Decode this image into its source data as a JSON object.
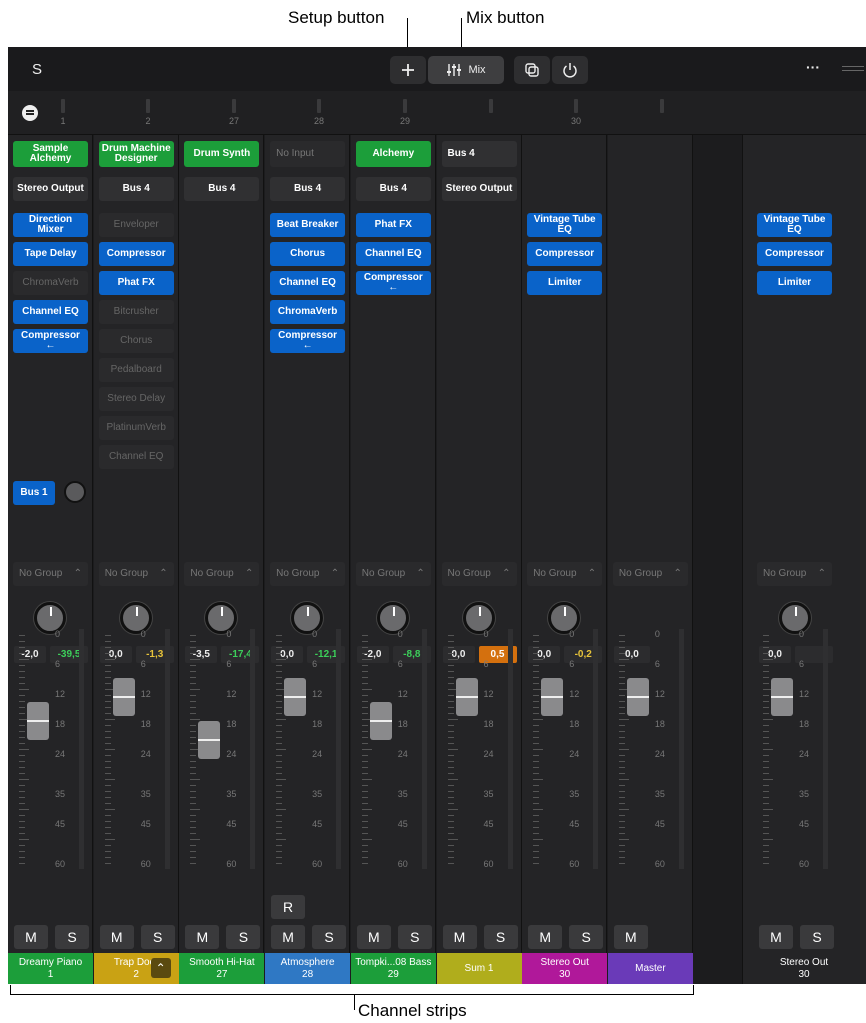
{
  "callouts": {
    "setup": "Setup button",
    "mix": "Mix button",
    "strips": "Channel strips"
  },
  "toolbar": {
    "left_label": "S",
    "add_icon": "plus-icon",
    "mix_icon": "mixer-sliders-icon",
    "mix_label": "Mix",
    "more": "···"
  },
  "ruler": [
    "1",
    "2",
    "27",
    "28",
    "29",
    "",
    "30"
  ],
  "strips": [
    {
      "input": "Sample Alchemy",
      "input_style": "green",
      "output": "Stereo Output",
      "plugins": [
        {
          "n": "Direction Mixer",
          "on": true
        },
        {
          "n": "Tape Delay",
          "on": true
        },
        {
          "n": "ChromaVerb",
          "on": false
        },
        {
          "n": "Channel EQ",
          "on": true
        },
        {
          "n": "Compressor ←",
          "on": true
        }
      ],
      "send": "Bus 1",
      "group": "No Group",
      "vol": "-2,0",
      "peak": "-39,5",
      "peak_color": "#3ccf5a",
      "peak_bg": "#2c2c2e",
      "fader_level": 0.32,
      "name": "Dreamy Piano",
      "num": "1",
      "color": "#1c9e3a",
      "rec": false,
      "ms": [
        "M",
        "S"
      ]
    },
    {
      "input": "Drum Machine Designer",
      "input_style": "green",
      "output": "Bus 4",
      "plugins": [
        {
          "n": "Enveloper",
          "on": false
        },
        {
          "n": "Compressor",
          "on": true
        },
        {
          "n": "Phat FX",
          "on": true
        },
        {
          "n": "Bitcrusher",
          "on": false
        },
        {
          "n": "Chorus",
          "on": false
        },
        {
          "n": "Pedalboard",
          "on": false
        },
        {
          "n": "Stereo Delay",
          "on": false
        },
        {
          "n": "PlatinumVerb",
          "on": false
        },
        {
          "n": "Channel EQ",
          "on": false
        }
      ],
      "send": "",
      "group": "No Group",
      "vol": "0,0",
      "peak": "-1,3",
      "peak_color": "#e8c43a",
      "peak_bg": "#2c2c2e",
      "fader_level": 0.22,
      "name": "Trap Door",
      "num": "2",
      "color": "#c9a214",
      "rec": false,
      "ms": [
        "M",
        "S"
      ]
    },
    {
      "input": "Drum Synth",
      "input_style": "green",
      "output": "Bus 4",
      "plugins": [],
      "send": "",
      "group": "No Group",
      "vol": "-3,5",
      "peak": "-17,4",
      "peak_color": "#3ccf5a",
      "peak_bg": "#2c2c2e",
      "fader_level": 0.4,
      "name": "Smooth Hi-Hat",
      "num": "27",
      "color": "#1c9e3a",
      "rec": false,
      "ms": [
        "M",
        "S"
      ]
    },
    {
      "input": "No Input",
      "input_style": "dark",
      "output": "Bus 4",
      "plugins": [
        {
          "n": "Beat Breaker",
          "on": true
        },
        {
          "n": "Chorus",
          "on": true
        },
        {
          "n": "Channel EQ",
          "on": true
        },
        {
          "n": "ChromaVerb",
          "on": true
        },
        {
          "n": "Compressor ←",
          "on": true
        }
      ],
      "send": "",
      "group": "No Group",
      "vol": "0,0",
      "peak": "-12,1",
      "peak_color": "#3ccf5a",
      "peak_bg": "#2c2c2e",
      "fader_level": 0.22,
      "name": "Atmosphere",
      "num": "28",
      "color": "#2f78c4",
      "rec": true,
      "rec_label": "R",
      "ms": [
        "M",
        "S"
      ]
    },
    {
      "input": "Alchemy",
      "input_style": "green",
      "output": "Bus 4",
      "plugins": [
        {
          "n": "Phat FX",
          "on": true
        },
        {
          "n": "Channel EQ",
          "on": true
        },
        {
          "n": "Compressor ←",
          "on": true
        }
      ],
      "send": "",
      "group": "No Group",
      "vol": "-2,0",
      "peak": "-8,8",
      "peak_color": "#3ccf5a",
      "peak_bg": "#2c2c2e",
      "fader_level": 0.32,
      "name": "Tompki...08 Bass",
      "num": "29",
      "color": "#1c9e3a",
      "rec": false,
      "ms": [
        "M",
        "S"
      ]
    },
    {
      "input": "Bus 4",
      "input_style": "gray",
      "output": "Stereo Output",
      "plugins": [],
      "send": "",
      "group": "No Group",
      "vol": "0,0",
      "peak": "0,5",
      "peak_color": "#ffffff",
      "peak_bg": "#d4700e",
      "fader_level": 0.22,
      "name": "Sum 1",
      "num": "",
      "color": "#b0ad1c",
      "rec": false,
      "ms": [
        "M",
        "S"
      ]
    },
    {
      "input": "",
      "input_style": "none",
      "output": "",
      "plugins": [
        {
          "n": "Vintage Tube EQ",
          "on": true
        },
        {
          "n": "Compressor",
          "on": true
        },
        {
          "n": "Limiter",
          "on": true
        }
      ],
      "send": "",
      "group": "No Group",
      "vol": "0,0",
      "peak": "-0,2",
      "peak_color": "#e8c43a",
      "peak_bg": "#2c2c2e",
      "fader_level": 0.22,
      "name": "Stereo Out",
      "num": "30",
      "color": "#b0189a",
      "rec": false,
      "ms": [
        "M",
        "S"
      ]
    },
    {
      "input": "",
      "input_style": "none",
      "output": "",
      "plugins": [],
      "send": "",
      "group": "No Group",
      "vol": "0,0",
      "peak": "",
      "peak_color": "#ffffff",
      "peak_bg": "none",
      "fader_level": 0.22,
      "name": "Master",
      "num": "",
      "color": "#6a3ab8",
      "rec": false,
      "ms": [
        "M"
      ]
    }
  ],
  "right_strip": {
    "plugins": [
      "Vintage Tube EQ",
      "Compressor",
      "Limiter"
    ],
    "group": "No Group",
    "vol": "0,0",
    "name": "Stereo Out",
    "num": "30",
    "ms": [
      "M",
      "S"
    ],
    "fader_level": 0.22
  },
  "scale_labels": [
    "0",
    "6",
    "12",
    "18",
    "24",
    "35",
    "45",
    "60"
  ],
  "colors": {
    "plugin_on": "#0a63c9",
    "instrument": "#1c9e3a",
    "background": "#1c1c1e"
  }
}
